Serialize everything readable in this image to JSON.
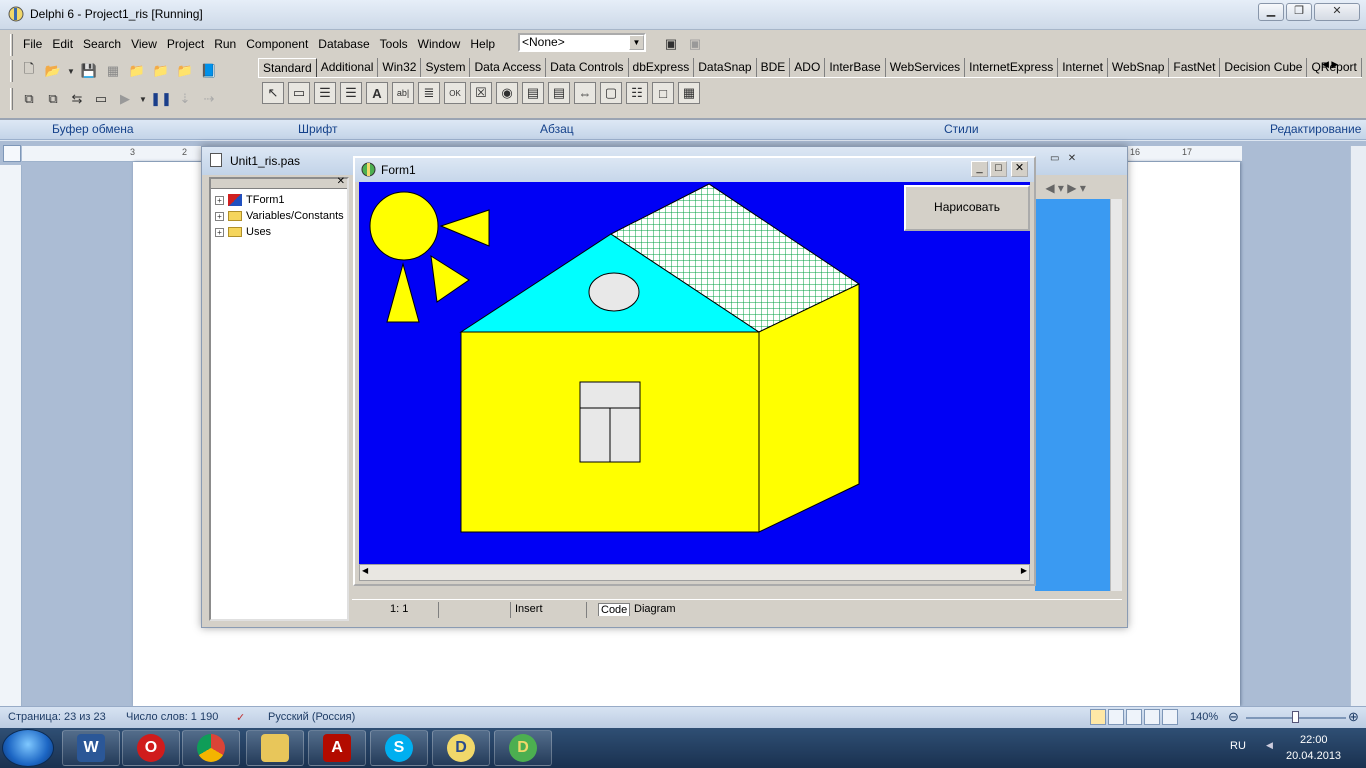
{
  "delphi": {
    "title": "Delphi 6 - Project1_ris [Running]",
    "menu": [
      "File",
      "Edit",
      "Search",
      "View",
      "Project",
      "Run",
      "Component",
      "Database",
      "Tools",
      "Window",
      "Help"
    ],
    "combo_value": "<None>",
    "palette_tabs": [
      "Standard",
      "Additional",
      "Win32",
      "System",
      "Data Access",
      "Data Controls",
      "dbExpress",
      "DataSnap",
      "BDE",
      "ADO",
      "InterBase",
      "WebServices",
      "InternetExpress",
      "Internet",
      "WebSnap",
      "FastNet",
      "Decision Cube",
      "QReport"
    ]
  },
  "ribbon": {
    "groups": [
      "Буфер обмена",
      "Шрифт",
      "Абзац",
      "Стили",
      "Редактирование"
    ]
  },
  "ruler": {
    "left_marks": [
      "3",
      "2"
    ],
    "right_marks": [
      "16",
      "17"
    ]
  },
  "unit": {
    "title": "Unit1_ris.pas",
    "tree": [
      "TForm1",
      "Variables/Constants",
      "Uses"
    ],
    "status": {
      "position": "1:   1",
      "mode": "Insert",
      "tab_code": "Code",
      "tab_diagram": "Diagram"
    }
  },
  "form": {
    "title": "Form1",
    "button_label": "Нарисовать"
  },
  "colors": {
    "sky": "#0000f5",
    "sun": "#ffff00",
    "house": "#ffff00",
    "roof_left": "#00ffff",
    "roof_right_grid": "#00a040",
    "window": "#e8e8e8",
    "accent": "#3a9af2"
  },
  "word_status": {
    "page": "Страница: 23 из 23",
    "words": "Число слов: 1 190",
    "language": "Русский (Россия)",
    "zoom": "140%"
  },
  "taskbar": {
    "apps": [
      "word-icon",
      "opera-icon",
      "chrome-icon",
      "explorer-icon",
      "acrobat-icon",
      "skype-icon",
      "delphi-icon",
      "delphi-project-icon"
    ],
    "lang": "RU",
    "time": "22:00",
    "date": "20.04.2013"
  }
}
